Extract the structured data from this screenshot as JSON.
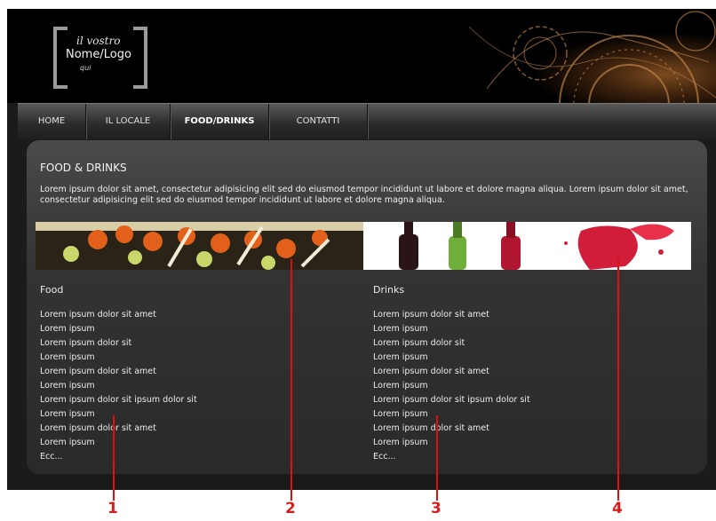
{
  "logo": {
    "line1": "il vostro",
    "line2": "Nome/Logo",
    "line3": "qui"
  },
  "nav": {
    "items": [
      "HOME",
      "IL LOCALE",
      "FOOD/DRINKS",
      "CONTATTI"
    ],
    "active": "FOOD/DRINKS"
  },
  "content": {
    "title": "FOOD & DRINKS",
    "intro": "Lorem ipsum dolor sit amet, consectetur adipisicing elit sed do eiusmod tempor incididunt ut labore et dolore magna aliqua. Lorem ipsum dolor sit amet, consectetur adipisicing elit sed do eiusmod tempor incididunt ut labore et dolore magna aliqua."
  },
  "food": {
    "heading": "Food",
    "items": [
      "Lorem ipsum dolor sit amet",
      "Lorem ipsum",
      "Lorem ipsum dolor sit",
      "Lorem ipsum",
      "Lorem ipsum dolor sit amet",
      "Lorem ipsum",
      "Lorem ipsum dolor sit ipsum dolor sit",
      "Lorem ipsum",
      "Lorem ipsum dolor sit amet",
      "Lorem ipsum",
      "Ecc..."
    ]
  },
  "drinks": {
    "heading": "Drinks",
    "items": [
      "Lorem ipsum dolor sit amet",
      "Lorem ipsum",
      "Lorem ipsum dolor sit",
      "Lorem ipsum",
      "Lorem ipsum dolor sit amet",
      "Lorem ipsum",
      "Lorem ipsum dolor sit ipsum dolor sit",
      "Lorem ipsum",
      "Lorem ipsum dolor sit amet",
      "Lorem ipsum",
      "Ecc..."
    ]
  },
  "annotations": [
    "1",
    "2",
    "3",
    "4"
  ],
  "colors": {
    "accent_red": "#d41e1e",
    "panel": "#333333",
    "background": "#000000"
  }
}
